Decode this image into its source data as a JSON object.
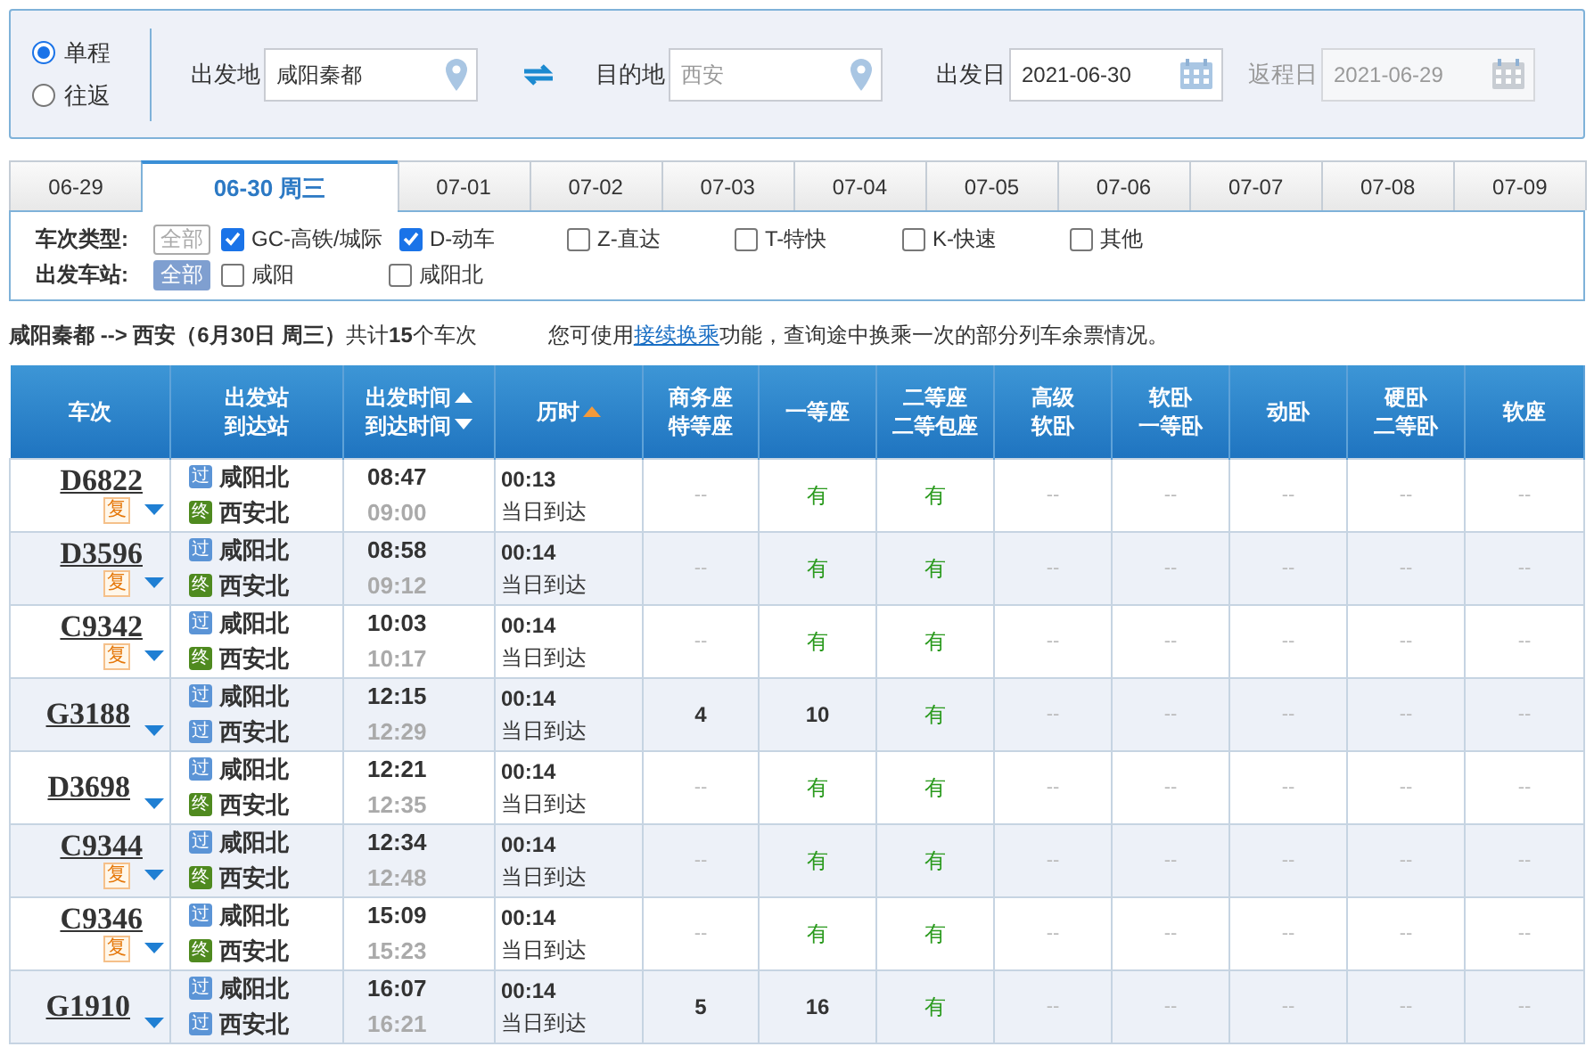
{
  "trip_type": [
    {
      "label": "单程",
      "selected": true
    },
    {
      "label": "往返",
      "selected": false
    }
  ],
  "fields": [
    {
      "label": "出发地",
      "value": "咸阳秦都",
      "kind": "station",
      "disabled": false,
      "dim": false
    },
    {
      "label": "目的地",
      "value": "西安",
      "kind": "station",
      "disabled": false,
      "dim": true
    },
    {
      "label": "出发日",
      "value": "2021-06-30",
      "kind": "date",
      "disabled": false,
      "dim": false
    },
    {
      "label": "返程日",
      "value": "2021-06-29",
      "kind": "date",
      "disabled": true,
      "dim": true
    }
  ],
  "date_tabs": [
    {
      "label": "06-29",
      "selected": false
    },
    {
      "label": "06-30 周三",
      "selected": true
    },
    {
      "label": "07-01",
      "selected": false
    },
    {
      "label": "07-02",
      "selected": false
    },
    {
      "label": "07-03",
      "selected": false
    },
    {
      "label": "07-04",
      "selected": false
    },
    {
      "label": "07-05",
      "selected": false
    },
    {
      "label": "07-06",
      "selected": false
    },
    {
      "label": "07-07",
      "selected": false
    },
    {
      "label": "07-08",
      "selected": false
    },
    {
      "label": "07-09",
      "selected": false
    }
  ],
  "filters": [
    {
      "label": "车次类型:",
      "all": {
        "label": "全部",
        "selected": false
      },
      "options": [
        {
          "label": "GC-高铁/城际",
          "checked": true
        },
        {
          "label": "D-动车",
          "checked": true
        },
        {
          "label": "Z-直达",
          "checked": false
        },
        {
          "label": "T-特快",
          "checked": false
        },
        {
          "label": "K-快速",
          "checked": false
        },
        {
          "label": "其他",
          "checked": false
        }
      ]
    },
    {
      "label": "出发车站:",
      "all": {
        "label": "全部",
        "selected": true
      },
      "options": [
        {
          "label": "咸阳",
          "checked": false
        },
        {
          "label": "咸阳北",
          "checked": false
        }
      ]
    }
  ],
  "summary": "**咸阳秦都 --> 西安（6月30日  周三）**共计**15**个车次",
  "note": {
    "before": "您可使用",
    "link": "接续换乘",
    "after": "功能，查询途中换乘一次的部分列车余票情况。"
  },
  "table": {
    "columns": [
      {
        "lines": [
          {
            "text": "车次"
          }
        ]
      },
      {
        "lines": [
          {
            "text": "出发站"
          },
          {
            "text": "到达站"
          }
        ]
      },
      {
        "lines": [
          {
            "text": "出发时间",
            "sort_up": true
          },
          {
            "text": "到达时间",
            "sort_down": true
          }
        ],
        "sort_active": false
      },
      {
        "lines": [
          {
            "text": "历时",
            "sort_up": true
          }
        ],
        "sort_active": true
      },
      {
        "lines": [
          {
            "text": "商务座"
          },
          {
            "text": "特等座"
          }
        ]
      },
      {
        "lines": [
          {
            "text": "一等座"
          }
        ]
      },
      {
        "lines": [
          {
            "text": "二等座"
          },
          {
            "text": "二等包座"
          }
        ]
      },
      {
        "lines": [
          {
            "text": "高级"
          },
          {
            "text": "软卧"
          }
        ]
      },
      {
        "lines": [
          {
            "text": "软卧"
          },
          {
            "text": "一等卧"
          }
        ]
      },
      {
        "lines": [
          {
            "text": "动卧"
          }
        ]
      },
      {
        "lines": [
          {
            "text": "硬卧"
          },
          {
            "text": "二等卧"
          }
        ]
      },
      {
        "lines": [
          {
            "text": "软座"
          }
        ]
      }
    ],
    "rows": [
      {
        "train": "D6822",
        "fu": "复",
        "stations": [
          {
            "tag": "过",
            "kind": "pass",
            "name": "咸阳北"
          },
          {
            "tag": "终",
            "kind": "end",
            "name": "西安北"
          }
        ],
        "depart": "08:47",
        "arrive": "09:00",
        "duration": "00:13",
        "arrival_day": "当日到达",
        "seats": [
          {
            "text": "--",
            "kind": "none"
          },
          {
            "text": "有",
            "kind": "available"
          },
          {
            "text": "有",
            "kind": "available"
          },
          {
            "text": "--",
            "kind": "none"
          },
          {
            "text": "--",
            "kind": "none"
          },
          {
            "text": "--",
            "kind": "none"
          },
          {
            "text": "--",
            "kind": "none"
          },
          {
            "text": "--",
            "kind": "none"
          }
        ]
      },
      {
        "train": "D3596",
        "fu": "复",
        "stations": [
          {
            "tag": "过",
            "kind": "pass",
            "name": "咸阳北"
          },
          {
            "tag": "终",
            "kind": "end",
            "name": "西安北"
          }
        ],
        "depart": "08:58",
        "arrive": "09:12",
        "duration": "00:14",
        "arrival_day": "当日到达",
        "seats": [
          {
            "text": "--",
            "kind": "none"
          },
          {
            "text": "有",
            "kind": "available"
          },
          {
            "text": "有",
            "kind": "available"
          },
          {
            "text": "--",
            "kind": "none"
          },
          {
            "text": "--",
            "kind": "none"
          },
          {
            "text": "--",
            "kind": "none"
          },
          {
            "text": "--",
            "kind": "none"
          },
          {
            "text": "--",
            "kind": "none"
          }
        ]
      },
      {
        "train": "C9342",
        "fu": "复",
        "stations": [
          {
            "tag": "过",
            "kind": "pass",
            "name": "咸阳北"
          },
          {
            "tag": "终",
            "kind": "end",
            "name": "西安北"
          }
        ],
        "depart": "10:03",
        "arrive": "10:17",
        "duration": "00:14",
        "arrival_day": "当日到达",
        "seats": [
          {
            "text": "--",
            "kind": "none"
          },
          {
            "text": "有",
            "kind": "available"
          },
          {
            "text": "有",
            "kind": "available"
          },
          {
            "text": "--",
            "kind": "none"
          },
          {
            "text": "--",
            "kind": "none"
          },
          {
            "text": "--",
            "kind": "none"
          },
          {
            "text": "--",
            "kind": "none"
          },
          {
            "text": "--",
            "kind": "none"
          }
        ]
      },
      {
        "train": "G3188",
        "stations": [
          {
            "tag": "过",
            "kind": "pass",
            "name": "咸阳北"
          },
          {
            "tag": "过",
            "kind": "pass",
            "name": "西安北"
          }
        ],
        "depart": "12:15",
        "arrive": "12:29",
        "duration": "00:14",
        "arrival_day": "当日到达",
        "seats": [
          {
            "text": "4",
            "kind": "count"
          },
          {
            "text": "10",
            "kind": "count"
          },
          {
            "text": "有",
            "kind": "available"
          },
          {
            "text": "--",
            "kind": "none"
          },
          {
            "text": "--",
            "kind": "none"
          },
          {
            "text": "--",
            "kind": "none"
          },
          {
            "text": "--",
            "kind": "none"
          },
          {
            "text": "--",
            "kind": "none"
          }
        ]
      },
      {
        "train": "D3698",
        "stations": [
          {
            "tag": "过",
            "kind": "pass",
            "name": "咸阳北"
          },
          {
            "tag": "终",
            "kind": "end",
            "name": "西安北"
          }
        ],
        "depart": "12:21",
        "arrive": "12:35",
        "duration": "00:14",
        "arrival_day": "当日到达",
        "seats": [
          {
            "text": "--",
            "kind": "none"
          },
          {
            "text": "有",
            "kind": "available"
          },
          {
            "text": "有",
            "kind": "available"
          },
          {
            "text": "--",
            "kind": "none"
          },
          {
            "text": "--",
            "kind": "none"
          },
          {
            "text": "--",
            "kind": "none"
          },
          {
            "text": "--",
            "kind": "none"
          },
          {
            "text": "--",
            "kind": "none"
          }
        ]
      },
      {
        "train": "C9344",
        "fu": "复",
        "stations": [
          {
            "tag": "过",
            "kind": "pass",
            "name": "咸阳北"
          },
          {
            "tag": "终",
            "kind": "end",
            "name": "西安北"
          }
        ],
        "depart": "12:34",
        "arrive": "12:48",
        "duration": "00:14",
        "arrival_day": "当日到达",
        "seats": [
          {
            "text": "--",
            "kind": "none"
          },
          {
            "text": "有",
            "kind": "available"
          },
          {
            "text": "有",
            "kind": "available"
          },
          {
            "text": "--",
            "kind": "none"
          },
          {
            "text": "--",
            "kind": "none"
          },
          {
            "text": "--",
            "kind": "none"
          },
          {
            "text": "--",
            "kind": "none"
          },
          {
            "text": "--",
            "kind": "none"
          }
        ]
      },
      {
        "train": "C9346",
        "fu": "复",
        "stations": [
          {
            "tag": "过",
            "kind": "pass",
            "name": "咸阳北"
          },
          {
            "tag": "终",
            "kind": "end",
            "name": "西安北"
          }
        ],
        "depart": "15:09",
        "arrive": "15:23",
        "duration": "00:14",
        "arrival_day": "当日到达",
        "seats": [
          {
            "text": "--",
            "kind": "none"
          },
          {
            "text": "有",
            "kind": "available"
          },
          {
            "text": "有",
            "kind": "available"
          },
          {
            "text": "--",
            "kind": "none"
          },
          {
            "text": "--",
            "kind": "none"
          },
          {
            "text": "--",
            "kind": "none"
          },
          {
            "text": "--",
            "kind": "none"
          },
          {
            "text": "--",
            "kind": "none"
          }
        ]
      },
      {
        "train": "G1910",
        "stations": [
          {
            "tag": "过",
            "kind": "pass",
            "name": "咸阳北"
          },
          {
            "tag": "过",
            "kind": "pass",
            "name": "西安北"
          }
        ],
        "depart": "16:07",
        "arrive": "16:21",
        "duration": "00:14",
        "arrival_day": "当日到达",
        "seats": [
          {
            "text": "5",
            "kind": "count"
          },
          {
            "text": "16",
            "kind": "count"
          },
          {
            "text": "有",
            "kind": "available"
          },
          {
            "text": "--",
            "kind": "none"
          },
          {
            "text": "--",
            "kind": "none"
          },
          {
            "text": "--",
            "kind": "none"
          },
          {
            "text": "--",
            "kind": "none"
          },
          {
            "text": "--",
            "kind": "none"
          }
        ]
      }
    ]
  }
}
